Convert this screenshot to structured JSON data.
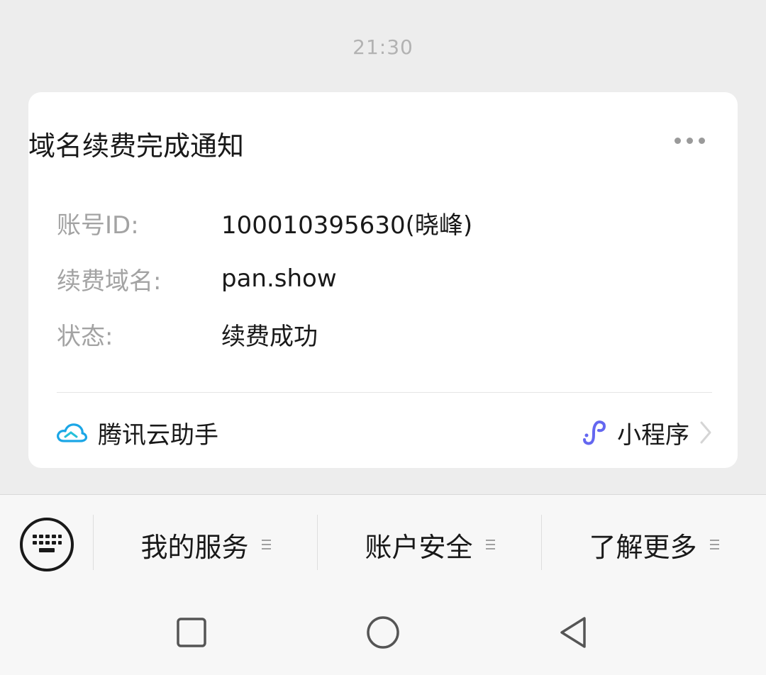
{
  "chat": {
    "timestamp": "21:30"
  },
  "card": {
    "title": "域名续费完成通知",
    "more_icon": "more-dots-icon",
    "fields": [
      {
        "label": "账号ID:",
        "value": "100010395630(晓峰)"
      },
      {
        "label": "续费域名:",
        "value": "pan.show"
      },
      {
        "label": "状态:",
        "value": "续费成功"
      }
    ],
    "source_name": "腾讯云助手",
    "source_icon": "tencent-cloud-icon",
    "miniprogram_label": "小程序",
    "miniprogram_icon": "miniprogram-link-icon"
  },
  "menu": {
    "keyboard_icon": "keyboard-icon",
    "items": [
      {
        "label": "我的服务"
      },
      {
        "label": "账户安全"
      },
      {
        "label": "了解更多"
      }
    ]
  },
  "system_nav": {
    "items": [
      "recent-apps-icon",
      "home-icon",
      "back-icon"
    ]
  },
  "colors": {
    "background": "#ededed",
    "card": "#ffffff",
    "label_gray": "#a3a3a3",
    "text": "#191919",
    "cloud_blue": "#1ba6e6",
    "miniprogram_purple": "#6467f0"
  }
}
